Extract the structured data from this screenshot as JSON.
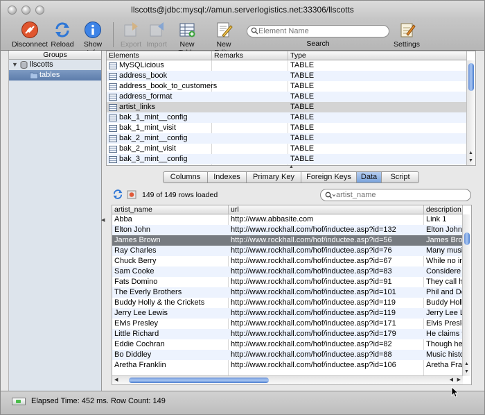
{
  "window": {
    "title": "llscotts@jdbc:mysql://amun.serverlogistics.net:33306/llscotts"
  },
  "toolbar": {
    "disconnect": "Disconnect",
    "reload": "Reload",
    "show_info": "Show Info",
    "export": "Export",
    "import": "Import",
    "new_table": "New Table",
    "new_editor": "New Editor",
    "search_placeholder": "Element Name",
    "search_label": "Search",
    "settings": "Settings"
  },
  "sidebar": {
    "header": "Groups",
    "items": [
      {
        "label": "llscotts",
        "expanded": true
      },
      {
        "label": "tables",
        "selected": true
      }
    ]
  },
  "elements": {
    "columns": [
      "Elements",
      "Remarks",
      "Type"
    ],
    "rows": [
      {
        "name": "MySQLicious",
        "remarks": "",
        "type": "TABLE"
      },
      {
        "name": "address_book",
        "remarks": "",
        "type": "TABLE"
      },
      {
        "name": "address_book_to_customers",
        "remarks": "",
        "type": "TABLE"
      },
      {
        "name": "address_format",
        "remarks": "",
        "type": "TABLE"
      },
      {
        "name": "artist_links",
        "remarks": "",
        "type": "TABLE",
        "selected": true
      },
      {
        "name": "bak_1_mint__config",
        "remarks": "",
        "type": "TABLE"
      },
      {
        "name": "bak_1_mint_visit",
        "remarks": "",
        "type": "TABLE"
      },
      {
        "name": "bak_2_mint__config",
        "remarks": "",
        "type": "TABLE"
      },
      {
        "name": "bak_2_mint_visit",
        "remarks": "",
        "type": "TABLE"
      },
      {
        "name": "bak_3_mint__config",
        "remarks": "",
        "type": "TABLE"
      }
    ]
  },
  "tabs": [
    {
      "label": "Columns"
    },
    {
      "label": "Indexes"
    },
    {
      "label": "Primary Key"
    },
    {
      "label": "Foreign Keys"
    },
    {
      "label": "Data",
      "active": true
    },
    {
      "label": "Script"
    }
  ],
  "data_view": {
    "rows_loaded": "149 of 149 rows loaded",
    "filter_placeholder": "artist_name",
    "columns": [
      "artist_name",
      "url",
      "description"
    ],
    "rows": [
      [
        "Abba",
        "http://www.abbasite.com",
        "Link 1"
      ],
      [
        "Elton John",
        "http://www.rockhall.com/hof/inductee.asp?id=132",
        "Elton John"
      ],
      [
        "James Brown",
        "http://www.rockhall.com/hof/inductee.asp?id=56",
        "James Brow"
      ],
      [
        "Ray Charles",
        "http://www.rockhall.com/hof/inductee.asp?id=76",
        "Many musi"
      ],
      [
        "Chuck Berry",
        "http://www.rockhall.com/hof/inductee.asp?id=67",
        "While no ir"
      ],
      [
        "Sam Cooke",
        "http://www.rockhall.com/hof/inductee.asp?id=83",
        "Considere"
      ],
      [
        "Fats Domino",
        "http://www.rockhall.com/hof/inductee.asp?id=91",
        "They call h"
      ],
      [
        "The Everly Brothers",
        "http://www.rockhall.com/hof/inductee.asp?id=101",
        "Phil and Do"
      ],
      [
        "Buddy Holly & the Crickets",
        "http://www.rockhall.com/hof/inductee.asp?id=119",
        "Buddy Holl"
      ],
      [
        "Jerry Lee Lewis",
        "http://www.rockhall.com/hof/inductee.asp?id=119",
        "Jerry Lee L"
      ],
      [
        "Elvis Presley",
        "http://www.rockhall.com/hof/inductee.asp?id=171",
        "Elvis Presle"
      ],
      [
        "Little Richard",
        "http://www.rockhall.com/hof/inductee.asp?id=179",
        "He claims t"
      ],
      [
        "Eddie Cochran",
        "http://www.rockhall.com/hof/inductee.asp?id=82",
        "Though he"
      ],
      [
        "Bo Diddley",
        "http://www.rockhall.com/hof/inductee.asp?id=88",
        "Music histo"
      ],
      [
        "Aretha Franklin",
        "http://www.rockhall.com/hof/inductee.asp?id=106",
        "Aretha Fra"
      ]
    ],
    "selected_row": 2
  },
  "status": {
    "text": "Elapsed Time: 452 ms. Row Count: 149"
  },
  "colors": {
    "selection": "#777b80",
    "accent": "#6b92d8",
    "row_alt": "#edf3fe"
  }
}
